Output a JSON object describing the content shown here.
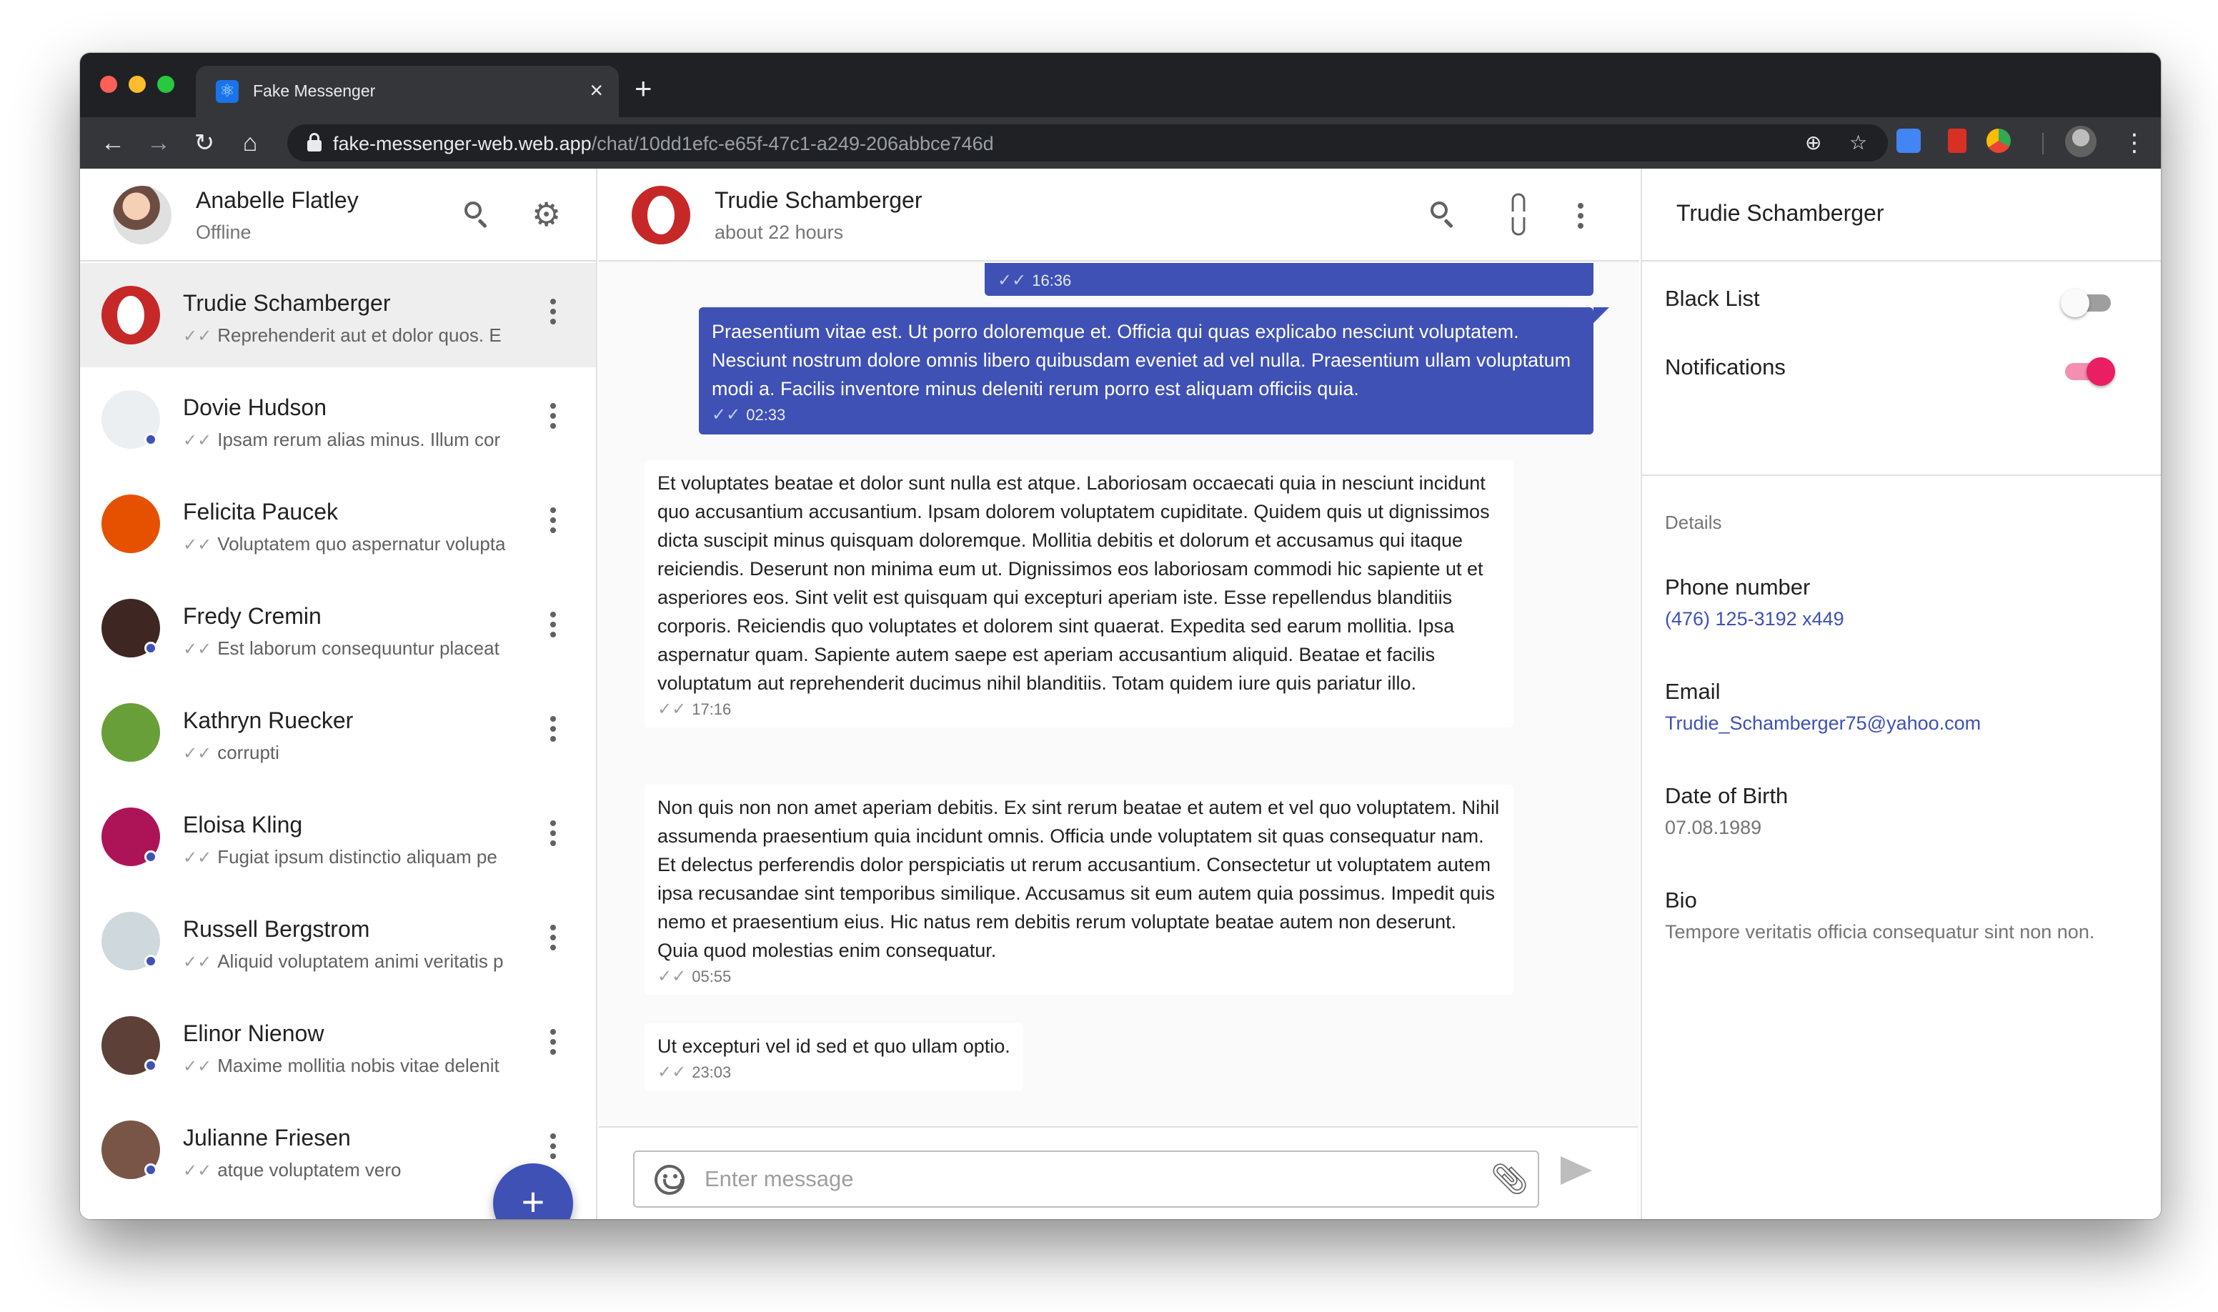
{
  "browser": {
    "tab_title": "Fake Messenger",
    "url_host": "fake-messenger-web.web.app",
    "url_path": "/chat/10dd1efc-e65f-47c1-a249-206abbce746d"
  },
  "me": {
    "name": "Anabelle Flatley",
    "status": "Offline"
  },
  "chats": [
    {
      "name": "Trudie Schamberger",
      "preview": "Reprehenderit aut et dolor quos. E",
      "avatar_color": "#c62828",
      "online": false,
      "active": true
    },
    {
      "name": "Dovie Hudson",
      "preview": "Ipsam rerum alias minus. Illum cor",
      "avatar_color": "#eceff1",
      "online": true,
      "active": false
    },
    {
      "name": "Felicita Paucek",
      "preview": "Voluptatem quo aspernatur volupta",
      "avatar_color": "#e65100",
      "online": false,
      "active": false
    },
    {
      "name": "Fredy Cremin",
      "preview": "Est laborum consequuntur placeat",
      "avatar_color": "#3e2723",
      "online": true,
      "active": false
    },
    {
      "name": "Kathryn Ruecker",
      "preview": "corrupti",
      "avatar_color": "#689f38",
      "online": false,
      "active": false
    },
    {
      "name": "Eloisa Kling",
      "preview": "Fugiat ipsum distinctio aliquam pe",
      "avatar_color": "#ad1457",
      "online": true,
      "active": false
    },
    {
      "name": "Russell Bergstrom",
      "preview": "Aliquid voluptatem animi veritatis p",
      "avatar_color": "#cfd8dc",
      "online": true,
      "active": false
    },
    {
      "name": "Elinor Nienow",
      "preview": "Maxime mollitia nobis vitae delenit",
      "avatar_color": "#5d4037",
      "online": true,
      "active": false
    },
    {
      "name": "Julianne Friesen",
      "preview": "atque voluptatem vero",
      "avatar_color": "#795548",
      "online": true,
      "active": false
    }
  ],
  "conversation": {
    "peer_name": "Trudie Schamberger",
    "peer_last_seen": "about 22 hours",
    "messages": [
      {
        "direction": "out",
        "text": "",
        "time": "16:36"
      },
      {
        "direction": "out",
        "text": "Praesentium vitae est. Ut porro doloremque et. Officia qui quas explicabo nesciunt voluptatem. Nesciunt nostrum dolore omnis libero quibusdam eveniet ad vel nulla. Praesentium ullam voluptatum modi a. Facilis inventore minus deleniti rerum porro est aliquam officiis quia.",
        "time": "02:33"
      },
      {
        "direction": "in",
        "text": "Et voluptates beatae et dolor sunt nulla est atque. Laboriosam occaecati quia in nesciunt incidunt quo accusantium accusantium. Ipsam dolorem voluptatem cupiditate. Quidem quis ut dignissimos dicta suscipit minus quisquam doloremque. Mollitia debitis et dolorum et accusamus qui itaque reiciendis. Deserunt non minima eum ut. Dignissimos eos laboriosam commodi hic sapiente ut et asperiores eos. Sint velit est quisquam qui excepturi aperiam iste. Esse repellendus blanditiis corporis. Reiciendis quo voluptates et dolorem sint quaerat. Expedita sed earum mollitia. Ipsa aspernatur quam. Sapiente autem saepe est aperiam accusantium aliquid. Beatae et facilis voluptatum aut reprehenderit ducimus nihil blanditiis. Totam quidem iure quis pariatur illo.",
        "time": "17:16"
      },
      {
        "direction": "in",
        "text": "Non quis non non amet aperiam debitis. Ex sint rerum beatae et autem et vel quo voluptatem. Nihil assumenda praesentium quia incidunt omnis. Officia unde voluptatem sit quas consequatur nam. Et delectus perferendis dolor perspiciatis ut rerum accusantium. Consectetur ut voluptatem autem ipsa recusandae sint temporibus similique. Accusamus sit eum autem quia possimus. Impedit quis nemo et praesentium eius. Hic natus rem debitis rerum voluptate beatae autem non deserunt. Quia quod molestias enim consequatur.",
        "time": "05:55"
      },
      {
        "direction": "in",
        "text": "Ut excepturi vel id sed et quo ullam optio.",
        "time": "23:03"
      }
    ],
    "input_placeholder": "Enter message",
    "input_value": ""
  },
  "details": {
    "title": "Trudie Schamberger",
    "black_list_label": "Black List",
    "black_list_on": false,
    "notifications_label": "Notifications",
    "notifications_on": true,
    "section_label": "Details",
    "phone_label": "Phone number",
    "phone_value": "(476) 125-3192 x449",
    "email_label": "Email",
    "email_value": "Trudie_Schamberger75@yahoo.com",
    "dob_label": "Date of Birth",
    "dob_value": "07.08.1989",
    "bio_label": "Bio",
    "bio_value": "Tempore veritatis officia consequatur sint non non."
  },
  "colors": {
    "primary": "#3f51b5",
    "accent": "#e91e63",
    "chrome_dark": "#202124"
  }
}
